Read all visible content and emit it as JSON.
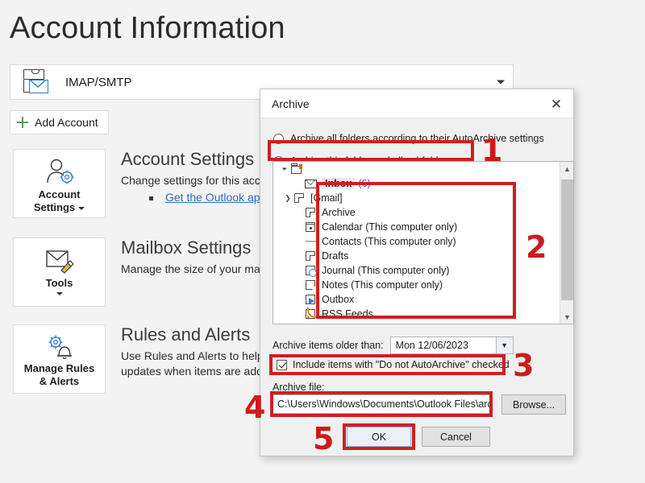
{
  "page": {
    "title": "Account Information"
  },
  "account": {
    "name": "IMAP/SMTP",
    "icon": "mail-account-icon",
    "dropdown_icon": "chevron-down-icon",
    "add_account_label": "Add Account",
    "add_icon": "plus-icon"
  },
  "sections": [
    {
      "tile_label_line1": "Account",
      "tile_label_line2": "Settings",
      "tile_icon": "person-gear-icon",
      "title": "Account Settings",
      "desc": "Change settings for this accou",
      "link": "Get the Outlook app for"
    },
    {
      "tile_label_line1": "Tools",
      "tile_label_line2": "",
      "tile_icon": "mailbox-cleanup-icon",
      "title": "Mailbox Settings",
      "desc": "Manage the size of your mailb",
      "link": ""
    },
    {
      "tile_label_line1": "Manage Rules",
      "tile_label_line2": "& Alerts",
      "tile_icon": "gear-bell-icon",
      "title": "Rules and Alerts",
      "desc": "Use Rules and Alerts to help o",
      "desc2": "updates when items are adde",
      "link": ""
    }
  ],
  "dialog": {
    "title": "Archive",
    "close_icon": "close-icon",
    "radio_all": "Archive all folders according to their AutoArchive settings",
    "radio_this": "Archive this folder and all subfolders:",
    "radio_selected": "radio_this",
    "tree": {
      "root_label": "",
      "root_icon": "mail-store-icon",
      "items": [
        {
          "label": "Inbox",
          "count": "(6)",
          "icon": "envelope-icon",
          "selected": true,
          "expandable": false
        },
        {
          "label": "[Gmail]",
          "count": "",
          "icon": "folder-icon",
          "selected": false,
          "expandable": true
        },
        {
          "label": "Archive",
          "count": "",
          "icon": "folder-icon",
          "selected": false,
          "expandable": false
        },
        {
          "label": "Calendar (This computer only)",
          "count": "",
          "icon": "calendar-icon",
          "selected": false,
          "expandable": false
        },
        {
          "label": "Contacts (This computer only)",
          "count": "",
          "icon": "contacts-icon",
          "selected": false,
          "expandable": false
        },
        {
          "label": "Drafts",
          "count": "",
          "icon": "folder-icon",
          "selected": false,
          "expandable": false
        },
        {
          "label": "Journal (This computer only)",
          "count": "",
          "icon": "journal-icon",
          "selected": false,
          "expandable": false
        },
        {
          "label": "Notes (This computer only)",
          "count": "",
          "icon": "notes-icon",
          "selected": false,
          "expandable": false
        },
        {
          "label": "Outbox",
          "count": "",
          "icon": "outbox-icon",
          "selected": false,
          "expandable": false
        },
        {
          "label": "RSS Feeds",
          "count": "",
          "icon": "rss-icon",
          "selected": false,
          "expandable": false
        }
      ],
      "scroll_up_icon": "chevron-up-icon",
      "scroll_down_icon": "chevron-down-icon"
    },
    "older_than_label": "Archive items older than:",
    "older_than_value": "Mon 12/06/2023",
    "older_than_dropdown_icon": "chevron-down-icon",
    "include_checkbox_label": "Include items with \"Do not AutoArchive\" checked",
    "include_checkbox_checked": true,
    "archive_file_label": "Archive file:",
    "archive_file_value": "C:\\Users\\Windows\\Documents\\Outlook Files\\archiv",
    "browse_label": "Browse...",
    "ok_label": "OK",
    "cancel_label": "Cancel"
  },
  "annotations": {
    "color": "#cc1b1b",
    "steps": [
      "1",
      "2",
      "3",
      "4",
      "5"
    ]
  }
}
